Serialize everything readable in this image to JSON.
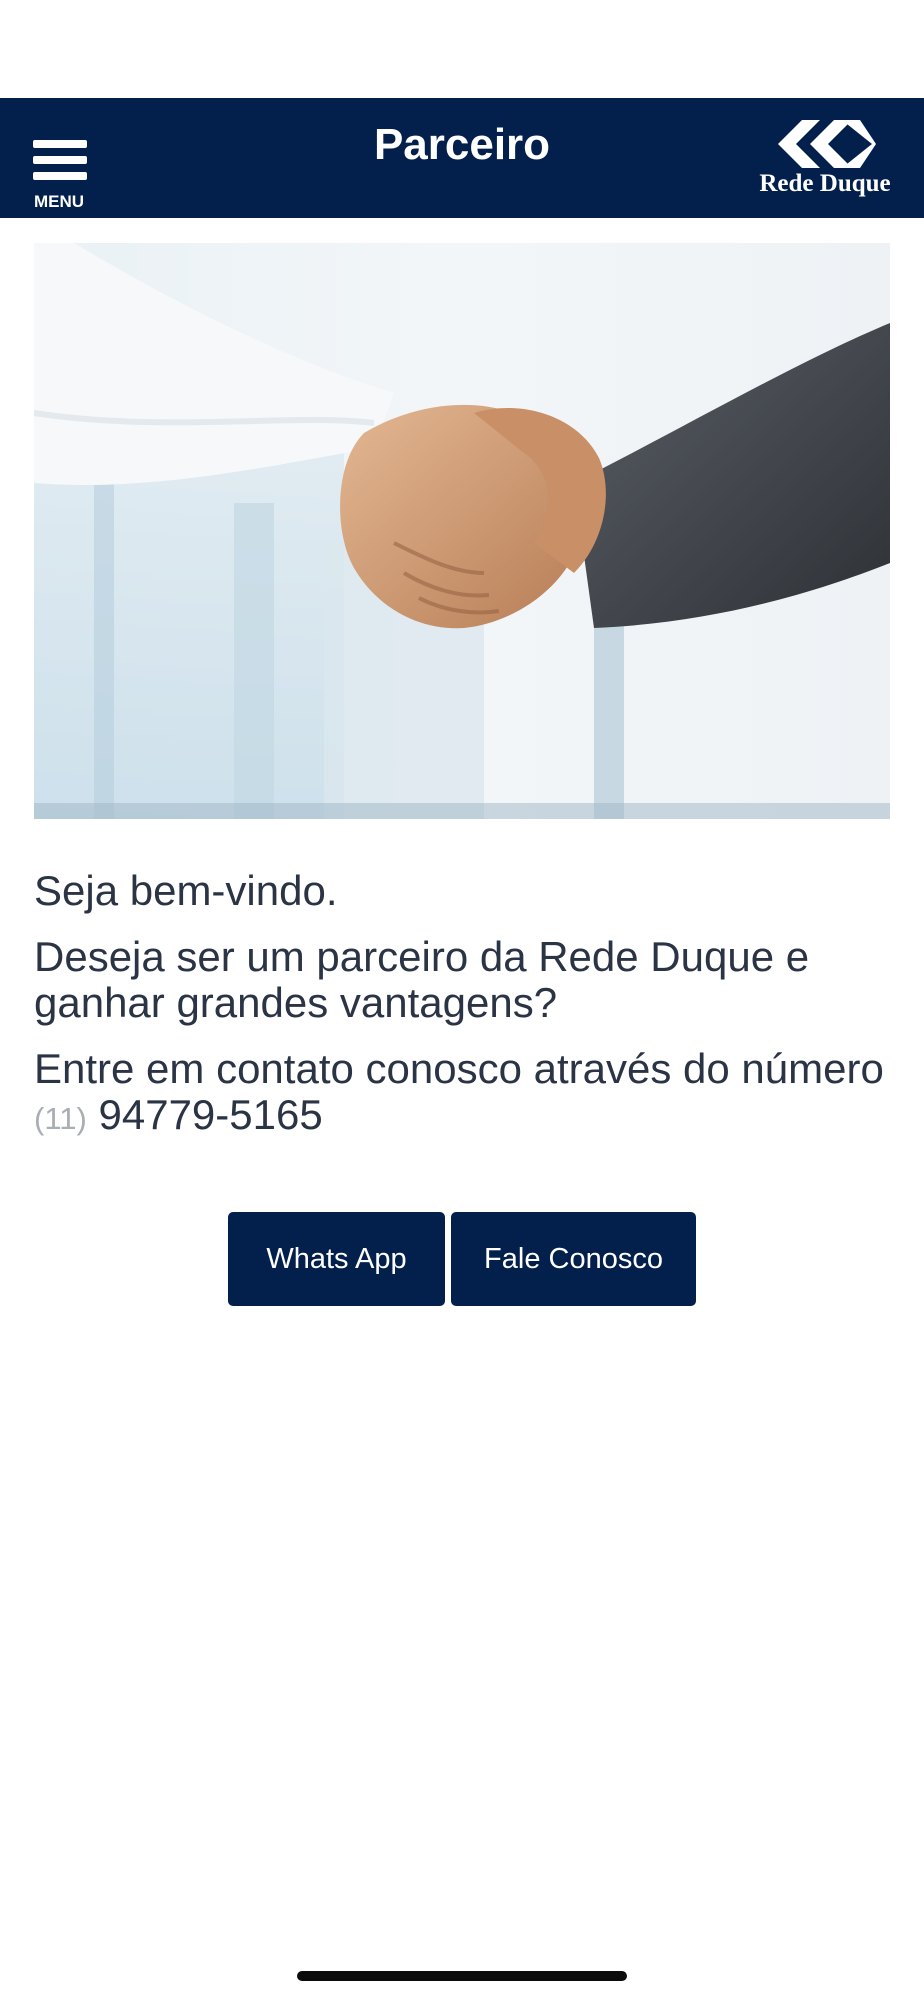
{
  "header": {
    "menu_label": "MENU",
    "title": "Parceiro",
    "logo_text": "Rede Duque",
    "background_color": "#03204c"
  },
  "hero": {
    "icon": "handshake-image"
  },
  "content": {
    "welcome": "Seja bem-vindo.",
    "question": "Deseja ser um parceiro da Rede Duque e ganhar grandes vantagens?",
    "contact_text": "Entre em contato conosco através do número",
    "area_code": "(11)",
    "phone_number": "94779-5165"
  },
  "buttons": {
    "whatsapp_label": "Whats App",
    "contact_label": "Fale Conosco"
  },
  "colors": {
    "primary": "#03204c",
    "text": "#2b3445",
    "muted": "#a9adb4"
  }
}
